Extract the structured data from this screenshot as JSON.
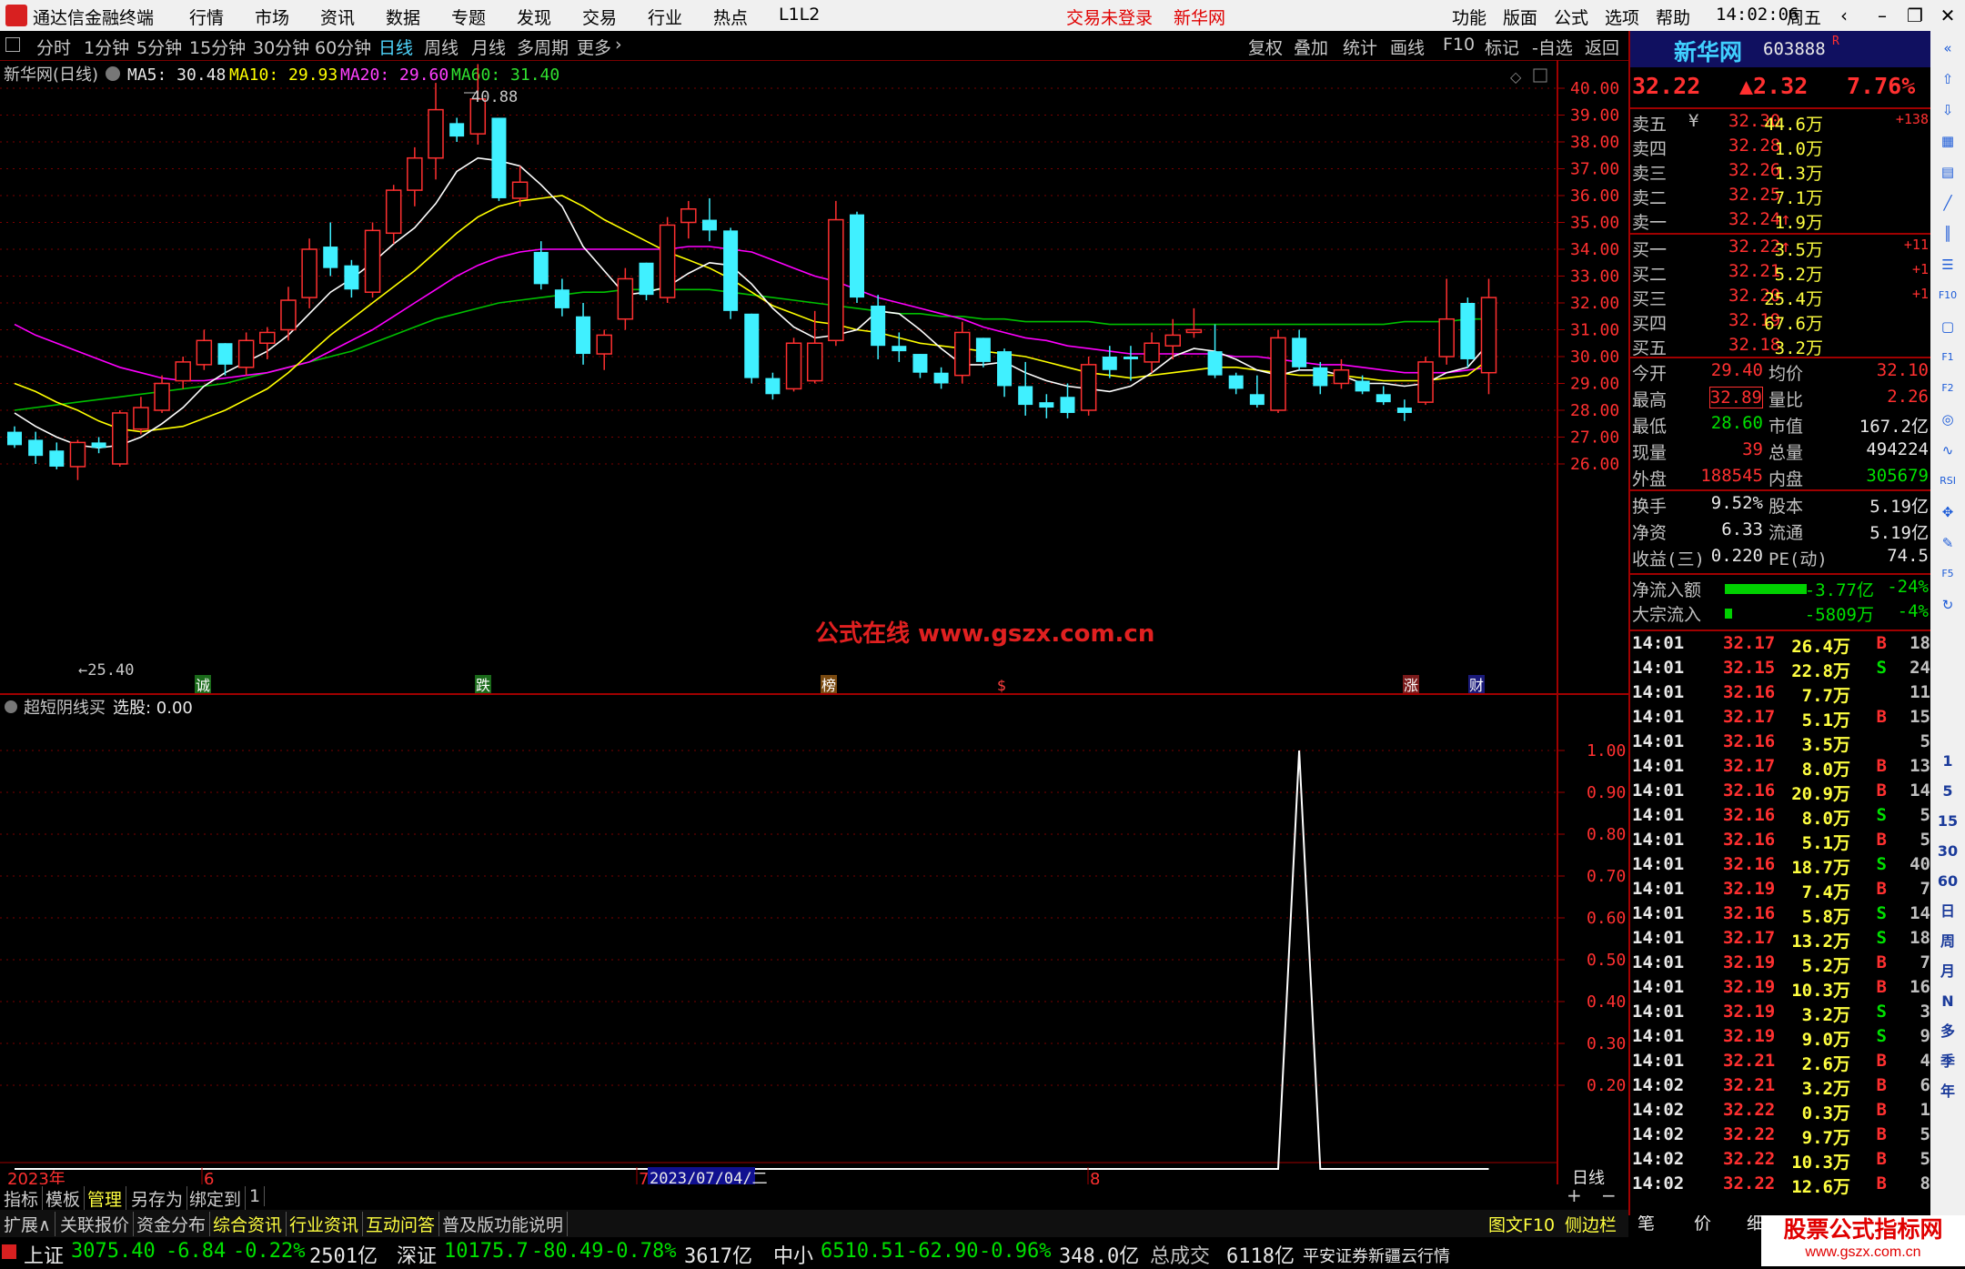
{
  "app": {
    "title": "通达信金融终端",
    "menu": [
      "行情",
      "市场",
      "资讯",
      "数据",
      "专题",
      "发现",
      "交易",
      "行业",
      "热点",
      "L1L2"
    ],
    "trade_status": "交易未登录",
    "stock_link": "新华网",
    "right_menu": [
      "功能",
      "版面",
      "公式",
      "选项",
      "帮助"
    ],
    "time": "14:02:06",
    "weekday": "周五"
  },
  "period_toolbar": {
    "items": [
      "分时",
      "1分钟",
      "5分钟",
      "15分钟",
      "30分钟",
      "60分钟",
      "日线",
      "周线",
      "月线",
      "多周期",
      "更多"
    ],
    "selected": "日线",
    "right_items": [
      "复权",
      "叠加",
      "统计",
      "画线",
      "F10",
      "标记",
      "-自选",
      "返回"
    ]
  },
  "chart_info": {
    "stock_label": "新华网(日线)",
    "ma5": "MA5: 30.48",
    "ma10": "MA10: 29.93",
    "ma20": "MA20: 29.60",
    "ma60": "MA60: 31.40",
    "high_label": "40.88",
    "low_label": "25.40",
    "watermark": "公式在线  www.gszx.com.cn",
    "event_marks": [
      "诚",
      "跌",
      "榜",
      "$",
      "涨",
      "财"
    ],
    "colors": {
      "ma5": "#ffffff",
      "ma10": "#ffff00",
      "ma20": "#ff00ff",
      "ma60": "#00c000",
      "up": "#ff3030",
      "down": "#40f0ff",
      "grid": "#7a0000"
    }
  },
  "indicator": {
    "name": "超短阴线买",
    "value_label": "选股: 0.00",
    "y_ticks": [
      "1.00",
      "0.90",
      "0.80",
      "0.70",
      "0.60",
      "0.50",
      "0.40",
      "0.30",
      "0.20"
    ]
  },
  "x_axis": {
    "labels": [
      "2023年",
      "6",
      "7",
      "2023/07/04/二",
      "8"
    ],
    "period": "日线"
  },
  "chart_data": {
    "type": "candlestick",
    "y_ticks": [
      40.0,
      39.0,
      38.0,
      37.0,
      36.0,
      35.0,
      34.0,
      33.0,
      32.0,
      31.0,
      30.0,
      29.0,
      28.0,
      27.0,
      26.0
    ],
    "ylim": [
      25.0,
      41.5
    ],
    "candles": [
      [
        27.2,
        27.4,
        26.6,
        26.7
      ],
      [
        26.9,
        27.2,
        26.0,
        26.3
      ],
      [
        26.5,
        26.8,
        25.8,
        25.9
      ],
      [
        25.9,
        26.9,
        25.4,
        26.8
      ],
      [
        26.8,
        27.0,
        26.4,
        26.6
      ],
      [
        26.0,
        28.0,
        25.9,
        27.9
      ],
      [
        27.3,
        28.5,
        27.1,
        28.1
      ],
      [
        28.0,
        29.3,
        27.9,
        29.0
      ],
      [
        29.1,
        30.0,
        28.8,
        29.8
      ],
      [
        29.7,
        31.0,
        29.5,
        30.6
      ],
      [
        30.5,
        30.5,
        29.3,
        29.7
      ],
      [
        29.6,
        30.9,
        29.3,
        30.6
      ],
      [
        30.5,
        31.1,
        29.9,
        30.9
      ],
      [
        31.0,
        32.6,
        30.6,
        32.1
      ],
      [
        32.2,
        34.4,
        31.8,
        34.0
      ],
      [
        34.1,
        35.0,
        33.0,
        33.3
      ],
      [
        33.4,
        33.6,
        32.2,
        32.5
      ],
      [
        32.4,
        35.0,
        32.2,
        34.7
      ],
      [
        34.6,
        36.4,
        34.2,
        36.2
      ],
      [
        36.2,
        37.8,
        35.6,
        37.4
      ],
      [
        37.4,
        40.2,
        36.6,
        39.2
      ],
      [
        38.7,
        38.9,
        38.0,
        38.2
      ],
      [
        38.3,
        40.9,
        37.9,
        39.6
      ],
      [
        38.9,
        38.9,
        35.8,
        35.9
      ],
      [
        35.9,
        37.1,
        35.6,
        36.5
      ],
      [
        33.9,
        34.3,
        32.5,
        32.7
      ],
      [
        32.5,
        32.9,
        31.5,
        31.8
      ],
      [
        31.5,
        32.0,
        29.7,
        30.1
      ],
      [
        30.1,
        31.0,
        29.5,
        30.8
      ],
      [
        31.4,
        33.3,
        31.0,
        32.9
      ],
      [
        33.5,
        33.5,
        32.1,
        32.3
      ],
      [
        32.2,
        35.2,
        32.0,
        34.9
      ],
      [
        35.0,
        35.8,
        34.4,
        35.5
      ],
      [
        35.1,
        35.9,
        34.3,
        34.7
      ],
      [
        34.7,
        34.8,
        31.4,
        31.7
      ],
      [
        31.6,
        31.6,
        29.0,
        29.2
      ],
      [
        29.2,
        29.4,
        28.4,
        28.6
      ],
      [
        28.8,
        30.7,
        28.7,
        30.5
      ],
      [
        29.1,
        31.7,
        29.0,
        30.5
      ],
      [
        30.6,
        35.8,
        30.4,
        35.1
      ],
      [
        35.3,
        35.4,
        32.0,
        32.2
      ],
      [
        31.9,
        32.3,
        29.9,
        30.4
      ],
      [
        30.4,
        30.9,
        29.8,
        30.2
      ],
      [
        30.1,
        30.1,
        29.2,
        29.4
      ],
      [
        29.4,
        29.6,
        28.8,
        29.0
      ],
      [
        29.3,
        31.3,
        29.0,
        30.9
      ],
      [
        30.7,
        30.7,
        29.6,
        29.8
      ],
      [
        30.2,
        30.3,
        28.5,
        28.9
      ],
      [
        28.9,
        29.8,
        27.8,
        28.2
      ],
      [
        28.3,
        28.6,
        27.7,
        28.1
      ],
      [
        28.5,
        29.0,
        27.7,
        27.9
      ],
      [
        28.0,
        30.0,
        27.8,
        29.7
      ],
      [
        30.0,
        30.4,
        29.2,
        29.5
      ],
      [
        30.0,
        30.4,
        29.1,
        29.9
      ],
      [
        29.8,
        30.9,
        29.4,
        30.5
      ],
      [
        30.4,
        31.4,
        29.9,
        30.8
      ],
      [
        30.9,
        31.8,
        30.7,
        31.0
      ],
      [
        30.2,
        31.2,
        29.2,
        29.3
      ],
      [
        29.3,
        29.4,
        28.6,
        28.8
      ],
      [
        28.6,
        29.3,
        28.1,
        28.2
      ],
      [
        28.0,
        31.0,
        27.9,
        30.7
      ],
      [
        30.7,
        31.0,
        29.5,
        29.6
      ],
      [
        29.6,
        29.8,
        28.6,
        28.9
      ],
      [
        29.0,
        29.9,
        28.8,
        29.5
      ],
      [
        29.1,
        29.3,
        28.6,
        28.7
      ],
      [
        28.6,
        28.9,
        28.2,
        28.3
      ],
      [
        28.1,
        28.4,
        27.6,
        27.9
      ],
      [
        28.3,
        30.0,
        28.2,
        29.8
      ],
      [
        30.0,
        32.9,
        29.7,
        31.4
      ],
      [
        32.0,
        32.2,
        29.6,
        29.9
      ],
      [
        29.4,
        32.9,
        28.6,
        32.2
      ]
    ],
    "ma5": [
      27.9,
      27.4,
      27.0,
      26.7,
      26.6,
      26.7,
      27.0,
      27.5,
      28.1,
      28.9,
      29.4,
      29.8,
      30.2,
      30.8,
      31.6,
      32.4,
      32.9,
      33.5,
      34.2,
      34.8,
      35.7,
      36.9,
      37.4,
      37.3,
      37.1,
      36.4,
      35.6,
      34.1,
      33.2,
      32.3,
      32.4,
      32.6,
      33.1,
      33.5,
      33.4,
      32.7,
      31.8,
      31.1,
      30.7,
      30.8,
      31.0,
      31.7,
      31.6,
      31.0,
      30.3,
      29.7,
      29.7,
      29.8,
      29.4,
      29.1,
      28.9,
      28.8,
      28.7,
      28.9,
      29.4,
      30.0,
      30.3,
      30.2,
      29.9,
      29.5,
      29.3,
      29.5,
      29.5,
      29.3,
      29.0,
      29.0,
      28.9,
      29.0,
      29.4,
      29.6,
      30.5
    ],
    "ma10": [
      29.0,
      28.7,
      28.3,
      28.0,
      27.6,
      27.3,
      27.2,
      27.3,
      27.4,
      27.7,
      28.0,
      28.4,
      28.8,
      29.4,
      30.1,
      30.8,
      31.4,
      32.0,
      32.6,
      33.2,
      33.9,
      34.6,
      35.2,
      35.6,
      35.8,
      35.9,
      36.0,
      35.6,
      35.1,
      34.7,
      34.3,
      33.9,
      33.6,
      33.3,
      32.9,
      32.4,
      31.9,
      31.6,
      31.3,
      31.2,
      31.0,
      30.9,
      30.7,
      30.5,
      30.4,
      30.3,
      30.2,
      30.1,
      30.0,
      29.8,
      29.6,
      29.4,
      29.3,
      29.2,
      29.3,
      29.4,
      29.5,
      29.6,
      29.6,
      29.5,
      29.4,
      29.3,
      29.3,
      29.3,
      29.2,
      29.1,
      29.1,
      29.1,
      29.2,
      29.3,
      29.9
    ],
    "ma20": [
      31.2,
      30.8,
      30.5,
      30.2,
      29.9,
      29.6,
      29.4,
      29.2,
      29.1,
      29.1,
      29.2,
      29.3,
      29.4,
      29.6,
      29.8,
      30.2,
      30.6,
      31.0,
      31.5,
      32.0,
      32.5,
      33.0,
      33.4,
      33.7,
      33.9,
      34.0,
      34.0,
      34.0,
      34.0,
      34.0,
      34.0,
      34.0,
      34.1,
      34.1,
      34.0,
      33.9,
      33.6,
      33.3,
      33.0,
      32.8,
      32.5,
      32.2,
      32.0,
      31.8,
      31.6,
      31.4,
      31.1,
      30.9,
      30.7,
      30.6,
      30.4,
      30.3,
      30.2,
      30.1,
      30.1,
      30.1,
      30.1,
      30.1,
      30.0,
      30.0,
      29.9,
      29.8,
      29.7,
      29.7,
      29.6,
      29.5,
      29.4,
      29.4,
      29.4,
      29.5,
      29.6
    ],
    "ma60": [
      28.0,
      28.1,
      28.2,
      28.3,
      28.4,
      28.5,
      28.6,
      28.7,
      28.8,
      28.9,
      29.0,
      29.2,
      29.4,
      29.6,
      29.8,
      30.0,
      30.2,
      30.5,
      30.8,
      31.1,
      31.4,
      31.6,
      31.8,
      32.0,
      32.1,
      32.2,
      32.3,
      32.4,
      32.4,
      32.5,
      32.5,
      32.5,
      32.5,
      32.5,
      32.4,
      32.3,
      32.2,
      32.1,
      32.0,
      31.9,
      31.8,
      31.7,
      31.6,
      31.6,
      31.5,
      31.5,
      31.4,
      31.4,
      31.3,
      31.3,
      31.3,
      31.3,
      31.2,
      31.2,
      31.2,
      31.2,
      31.2,
      31.2,
      31.2,
      31.2,
      31.2,
      31.2,
      31.2,
      31.2,
      31.2,
      31.2,
      31.3,
      31.3,
      31.3,
      31.4,
      31.4
    ],
    "signal": {
      "spike_index": 61,
      "value": 1.0
    }
  },
  "quote": {
    "name": "新华网",
    "code": "603888",
    "flag": "R",
    "price": "32.22",
    "change": "▲2.32",
    "change_pct": "7.76%",
    "asks": [
      {
        "label": "卖五",
        "mark": "¥",
        "price": "32.30",
        "vol": "44.6万",
        "delta": "+138"
      },
      {
        "label": "卖四",
        "mark": "",
        "price": "32.28",
        "vol": "1.0万",
        "delta": ""
      },
      {
        "label": "卖三",
        "mark": "",
        "price": "32.26",
        "vol": "1.3万",
        "delta": ""
      },
      {
        "label": "卖二",
        "mark": "",
        "price": "32.25",
        "vol": "7.1万",
        "delta": ""
      },
      {
        "label": "卖一",
        "mark": "",
        "price": "32.24↑",
        "vol": "1.9万",
        "delta": ""
      }
    ],
    "bids": [
      {
        "label": "买一",
        "price": "32.22↑",
        "vol": "3.5万",
        "delta": "+11"
      },
      {
        "label": "买二",
        "price": "32.21",
        "vol": "5.2万",
        "delta": "+1"
      },
      {
        "label": "买三",
        "price": "32.20",
        "vol": "25.4万",
        "delta": "+1"
      },
      {
        "label": "买四",
        "price": "32.19",
        "vol": "67.6万",
        "delta": ""
      },
      {
        "label": "买五",
        "price": "32.18",
        "vol": "3.2万",
        "delta": ""
      }
    ],
    "stats1": [
      {
        "l1": "今开",
        "v1": "29.40",
        "l2": "均价",
        "v2": "32.10"
      },
      {
        "l1": "最高",
        "v1": "32.89",
        "l2": "量比",
        "v2": "2.26"
      },
      {
        "l1": "最低",
        "v1": "28.60",
        "l2": "市值",
        "v2": "167.2亿"
      },
      {
        "l1": "现量",
        "v1": "39",
        "l2": "总量",
        "v2": "494224"
      },
      {
        "l1": "外盘",
        "v1": "188545",
        "l2": "内盘",
        "v2": "305679"
      }
    ],
    "stats2": [
      {
        "l1": "换手",
        "v1": "9.52%",
        "l2": "股本",
        "v2": "5.19亿"
      },
      {
        "l1": "净资",
        "v1": "6.33",
        "l2": "流通",
        "v2": "5.19亿"
      },
      {
        "l1": "收益(三)",
        "v1": "0.220",
        "l2": "PE(动)",
        "v2": "74.5"
      }
    ],
    "flows": [
      {
        "label": "净流入额",
        "value": "-3.77亿",
        "pct": "-24%",
        "bar_fraction": 0.85
      },
      {
        "label": "大宗流入",
        "value": "-5809万",
        "pct": "-4%",
        "bar_fraction": 0.08
      }
    ],
    "ticks": [
      [
        "14:01",
        "32.17",
        "26.4万",
        "B",
        "18"
      ],
      [
        "14:01",
        "32.15",
        "22.8万",
        "S",
        "24"
      ],
      [
        "14:01",
        "32.16",
        "7.7万",
        "",
        "11"
      ],
      [
        "14:01",
        "32.17",
        "5.1万",
        "B",
        "15"
      ],
      [
        "14:01",
        "32.16",
        "3.5万",
        "",
        "5"
      ],
      [
        "14:01",
        "32.17",
        "8.0万",
        "B",
        "13"
      ],
      [
        "14:01",
        "32.16",
        "20.9万",
        "B",
        "14"
      ],
      [
        "14:01",
        "32.16",
        "8.0万",
        "S",
        "5"
      ],
      [
        "14:01",
        "32.16",
        "5.1万",
        "B",
        "5"
      ],
      [
        "14:01",
        "32.16",
        "18.7万",
        "S",
        "40"
      ],
      [
        "14:01",
        "32.19",
        "7.4万",
        "B",
        "7"
      ],
      [
        "14:01",
        "32.16",
        "5.8万",
        "S",
        "14"
      ],
      [
        "14:01",
        "32.17",
        "13.2万",
        "S",
        "18"
      ],
      [
        "14:01",
        "32.19",
        "5.2万",
        "B",
        "7"
      ],
      [
        "14:01",
        "32.19",
        "10.3万",
        "B",
        "16"
      ],
      [
        "14:01",
        "32.19",
        "3.2万",
        "S",
        "3"
      ],
      [
        "14:01",
        "32.19",
        "9.0万",
        "S",
        "9"
      ],
      [
        "14:01",
        "32.21",
        "2.6万",
        "B",
        "4"
      ],
      [
        "14:02",
        "32.21",
        "3.2万",
        "B",
        "6"
      ],
      [
        "14:02",
        "32.22",
        "0.3万",
        "B",
        "1"
      ],
      [
        "14:02",
        "32.22",
        "9.7万",
        "B",
        "5"
      ],
      [
        "14:02",
        "32.22",
        "10.3万",
        "B",
        "5"
      ],
      [
        "14:02",
        "32.22",
        "12.6万",
        "B",
        "8"
      ]
    ]
  },
  "bottom": {
    "tabs1": [
      "指标",
      "模板",
      "管理",
      "另存为",
      "绑定到",
      "1"
    ],
    "tabs2": [
      "扩展∧",
      "关联报价",
      "资金分布",
      "综合资讯",
      "行业资讯",
      "互动问答",
      "普及版功能说明"
    ],
    "right_links": [
      "图文F10",
      "侧边栏《"
    ],
    "right_tabs": [
      "笔",
      "价",
      "细"
    ],
    "brand": "股票公式指标网",
    "brand_url": "www.gszx.com.cn",
    "indices": [
      {
        "name": "上证",
        "value": "3075.40",
        "chg": "-6.84",
        "pct": "-0.22%",
        "amt": "2501亿"
      },
      {
        "name": "深证",
        "value": "10175.7",
        "chg": "-80.49",
        "pct": "-0.78%",
        "amt": "3617亿"
      },
      {
        "name": "中小",
        "value": "6510.51",
        "chg": "-62.90",
        "pct": "-0.96%",
        "amt": "348.0亿"
      }
    ],
    "total_label": "总成交",
    "total_value": "6118亿",
    "broker": "平安证券新疆云行情"
  },
  "sidebar_icons": [
    "collapse-icon",
    "up-arrow-icon",
    "down-arrow-icon",
    "grid-icon",
    "table-icon",
    "chart-icon",
    "candle-icon",
    "list-icon",
    "f10-icon",
    "page-icon",
    "f1-icon",
    "f2-icon",
    "circle-icon",
    "wave-icon",
    "rsi-icon",
    "move-icon",
    "pen-icon",
    "f5-icon",
    "refresh-icon"
  ],
  "sidebar_periods": [
    "1",
    "5",
    "15",
    "30",
    "60",
    "日",
    "周",
    "月",
    "N",
    "多",
    "季",
    "年"
  ]
}
